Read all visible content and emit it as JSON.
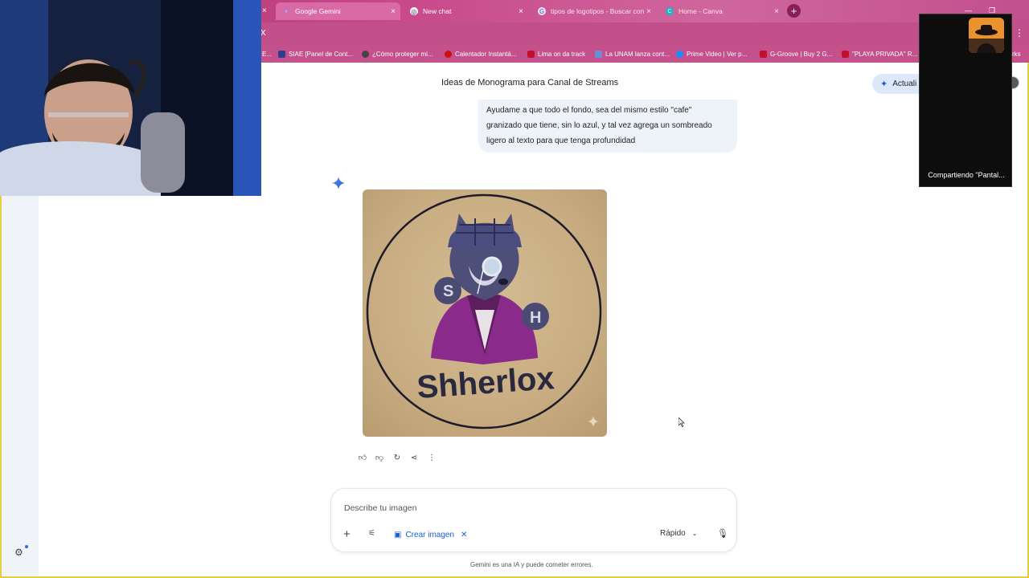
{
  "browser": {
    "tabs": [
      {
        "label": "Google Gemini",
        "active": true
      },
      {
        "label": "New chat",
        "active": false
      },
      {
        "label": "tipos de logotipos - Buscar con",
        "active": false
      },
      {
        "label": "Home - Canva",
        "active": false
      }
    ],
    "tab_close_glyph": "×",
    "new_tab_glyph": "+",
    "bookmarks": [
      {
        "label": "E..."
      },
      {
        "label": "SIAE [Panel de Cont..."
      },
      {
        "label": "¿Cómo proteger mi..."
      },
      {
        "label": "Calentador Instantá..."
      },
      {
        "label": "Lima on da track"
      },
      {
        "label": "La UNAM lanza cont..."
      },
      {
        "label": "Prime Video | Ver p..."
      },
      {
        "label": "G-Groove | Buy 2 G..."
      },
      {
        "label": "\"PLAYA PRIVADA\" R..."
      },
      {
        "label": "rks"
      }
    ]
  },
  "gemini": {
    "conversation_title": "Ideas de Monograma para Canal de Streams",
    "upgrade_label": "Actuali",
    "user_message": "Ayudame a que todo el fondo, sea del mismo estilo \"cafe\" granizado que tiene, sin lo azul, y tal vez agrega un sombreado ligero al texto para que tenga profundidad",
    "generated_image_text": "Shherlox",
    "generated_image_letters": [
      "S",
      "H"
    ],
    "input": {
      "placeholder": "Describe tu imagen",
      "value": ""
    },
    "create_chip_label": "Crear imagen",
    "mode_label": "Rápido",
    "disclaimer": "Gemini es una IA y puede cometer errores."
  },
  "share_panel": {
    "label": "Compartiendo \"Pantal..."
  },
  "colors": {
    "chrome_pink": "#c4508c",
    "accent_blue": "#1a5fd0",
    "user_bubble": "#eef2f9",
    "image_bg": "#c9ad82"
  },
  "icons": [
    "gemini-star-icon",
    "thumbs-up-icon",
    "thumbs-down-icon",
    "regenerate-icon",
    "share-icon",
    "more-icon",
    "plus-icon",
    "tools-icon",
    "image-icon",
    "close-icon",
    "chevron-down-icon",
    "mic-icon",
    "settings-icon"
  ]
}
